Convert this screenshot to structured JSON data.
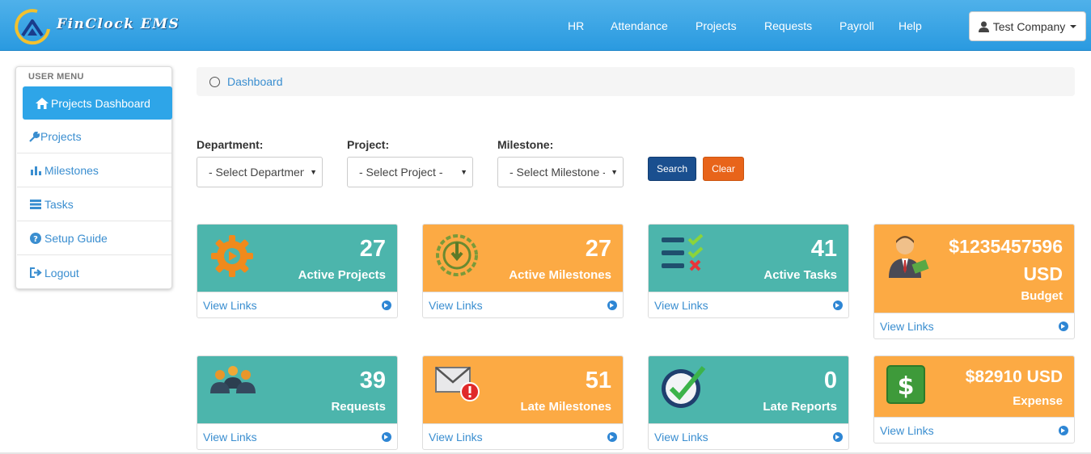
{
  "header": {
    "brand": "FinClock EMS",
    "nav": [
      "HR",
      "Attendance",
      "Projects",
      "Requests",
      "Payroll",
      "Help"
    ],
    "user_label": "Test Company"
  },
  "sidebar": {
    "heading": "USER MENU",
    "items": [
      {
        "label": "Projects Dashboard",
        "icon": "home-icon"
      },
      {
        "label": "Projects",
        "icon": "wrench-icon"
      },
      {
        "label": "Milestones",
        "icon": "bar-chart-icon"
      },
      {
        "label": "Tasks",
        "icon": "tasks-icon"
      },
      {
        "label": "Setup Guide",
        "icon": "question-icon"
      },
      {
        "label": "Logout",
        "icon": "logout-icon"
      }
    ]
  },
  "breadcrumb": {
    "label": "Dashboard"
  },
  "filters": {
    "department_label": "Department:",
    "department_value": "- Select Department -",
    "project_label": "Project:",
    "project_value": "- Select Project -",
    "milestone_label": "Milestone:",
    "milestone_value": "- Select Milestone -",
    "search_label": "Search",
    "clear_label": "Clear"
  },
  "cards": [
    {
      "value": "27",
      "label": "Active Projects",
      "link": "View Links",
      "color": "#4cb5ac",
      "icon": "gear-icon"
    },
    {
      "value": "27",
      "label": "Active Milestones",
      "link": "View Links",
      "color": "#fcaa44",
      "icon": "clock-icon"
    },
    {
      "value": "41",
      "label": "Active Tasks",
      "link": "View Links",
      "color": "#4cb5ac",
      "icon": "checklist-icon"
    },
    {
      "value": "$1235457596",
      "value2": "USD",
      "label": "Budget",
      "link": "View Links",
      "color": "#fcaa44",
      "icon": "businessman-icon"
    },
    {
      "value": "39",
      "label": "Requests",
      "link": "View Links",
      "color": "#4cb5ac",
      "icon": "group-icon"
    },
    {
      "value": "51",
      "label": "Late Milestones",
      "link": "View Links",
      "color": "#fcaa44",
      "icon": "mail-alert-icon"
    },
    {
      "value": "0",
      "label": "Late Reports",
      "link": "View Links",
      "color": "#4cb5ac",
      "icon": "clock-check-icon"
    },
    {
      "value": "$82910 USD",
      "label": "Expense",
      "link": "View Links",
      "color": "#fcaa44",
      "icon": "dollar-icon"
    }
  ]
}
